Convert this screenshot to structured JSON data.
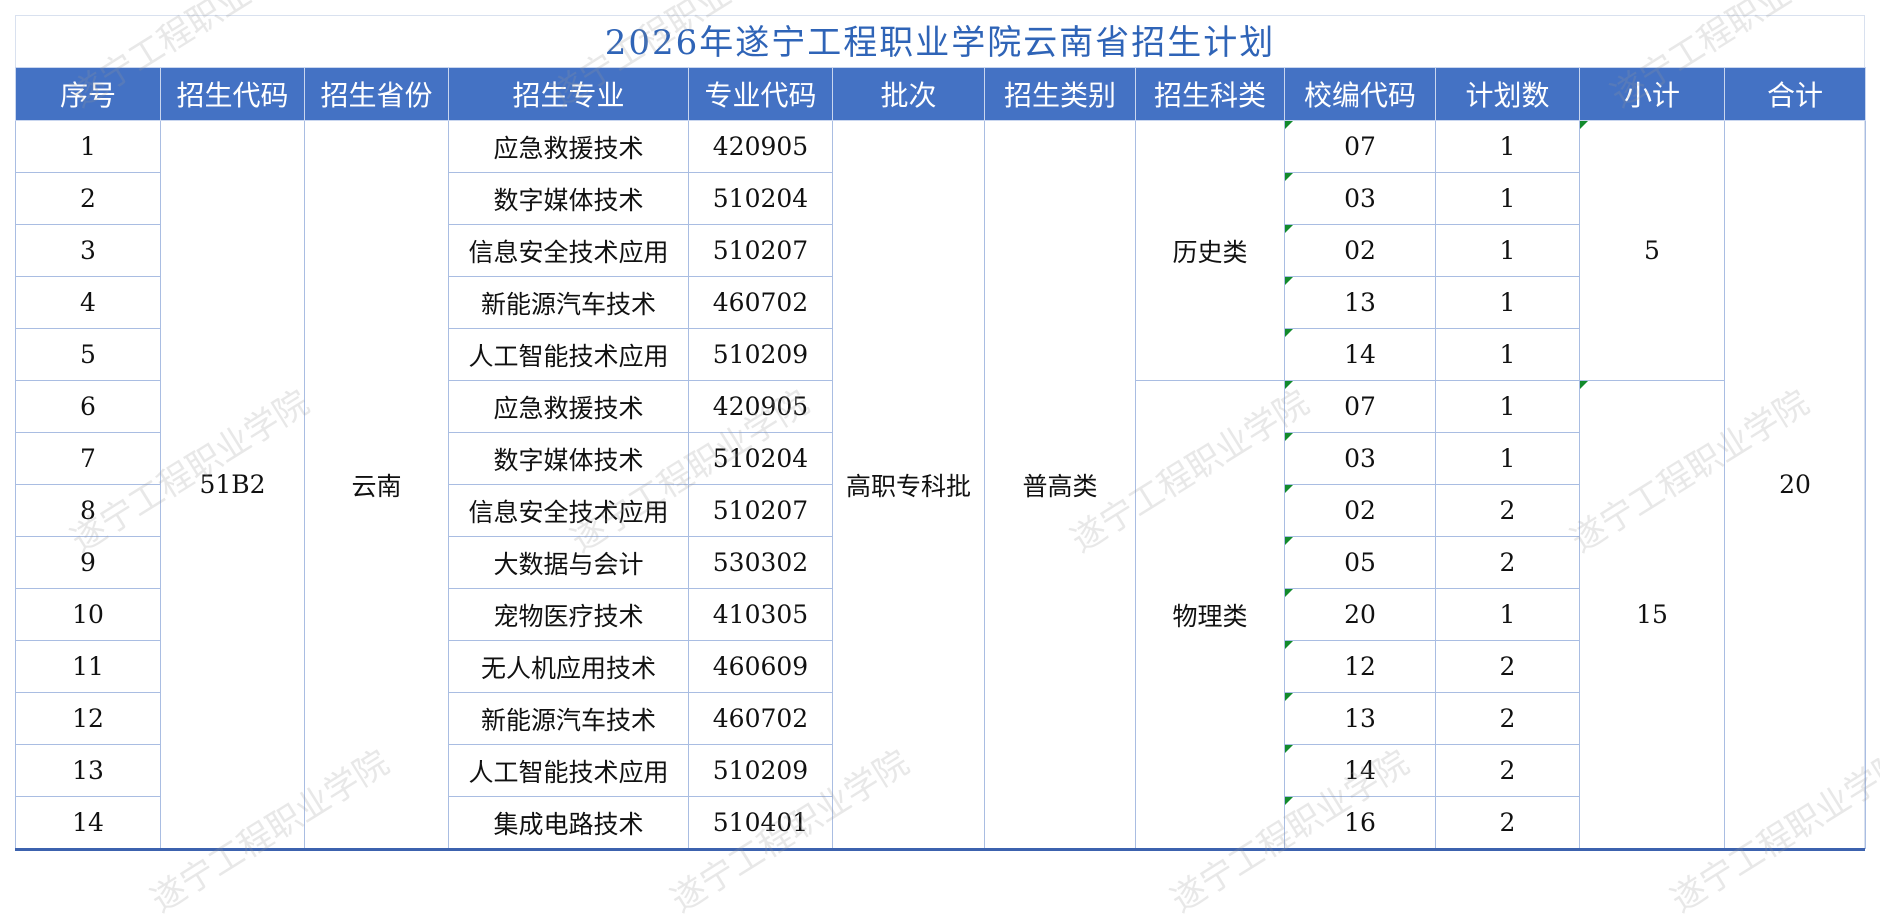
{
  "title": "2026年遂宁工程职业学院云南省招生计划",
  "headers": [
    "序号",
    "招生代码",
    "招生省份",
    "招生专业",
    "专业代码",
    "批次",
    "招生类别",
    "招生科类",
    "校编代码",
    "计划数",
    "小计",
    "合计"
  ],
  "recruit_code": "51B2",
  "province": "云南",
  "batch": "高职专科批",
  "category": "普高类",
  "groups": [
    {
      "subject": "历史类",
      "subtotal": "5"
    },
    {
      "subject": "物理类",
      "subtotal": "15"
    }
  ],
  "total": "20",
  "rows": [
    {
      "no": "1",
      "major": "应急救援技术",
      "major_code": "420905",
      "school_code": "07",
      "plan": "1"
    },
    {
      "no": "2",
      "major": "数字媒体技术",
      "major_code": "510204",
      "school_code": "03",
      "plan": "1"
    },
    {
      "no": "3",
      "major": "信息安全技术应用",
      "major_code": "510207",
      "school_code": "02",
      "plan": "1"
    },
    {
      "no": "4",
      "major": "新能源汽车技术",
      "major_code": "460702",
      "school_code": "13",
      "plan": "1"
    },
    {
      "no": "5",
      "major": "人工智能技术应用",
      "major_code": "510209",
      "school_code": "14",
      "plan": "1"
    },
    {
      "no": "6",
      "major": "应急救援技术",
      "major_code": "420905",
      "school_code": "07",
      "plan": "1"
    },
    {
      "no": "7",
      "major": "数字媒体技术",
      "major_code": "510204",
      "school_code": "03",
      "plan": "1"
    },
    {
      "no": "8",
      "major": "信息安全技术应用",
      "major_code": "510207",
      "school_code": "02",
      "plan": "2"
    },
    {
      "no": "9",
      "major": "大数据与会计",
      "major_code": "530302",
      "school_code": "05",
      "plan": "2"
    },
    {
      "no": "10",
      "major": "宠物医疗技术",
      "major_code": "410305",
      "school_code": "20",
      "plan": "1"
    },
    {
      "no": "11",
      "major": "无人机应用技术",
      "major_code": "460609",
      "school_code": "12",
      "plan": "2"
    },
    {
      "no": "12",
      "major": "新能源汽车技术",
      "major_code": "460702",
      "school_code": "13",
      "plan": "2"
    },
    {
      "no": "13",
      "major": "人工智能技术应用",
      "major_code": "510209",
      "school_code": "14",
      "plan": "2"
    },
    {
      "no": "14",
      "major": "集成电路技术",
      "major_code": "510401",
      "school_code": "16",
      "plan": "2"
    }
  ],
  "watermark": "遂宁工程职业学院"
}
